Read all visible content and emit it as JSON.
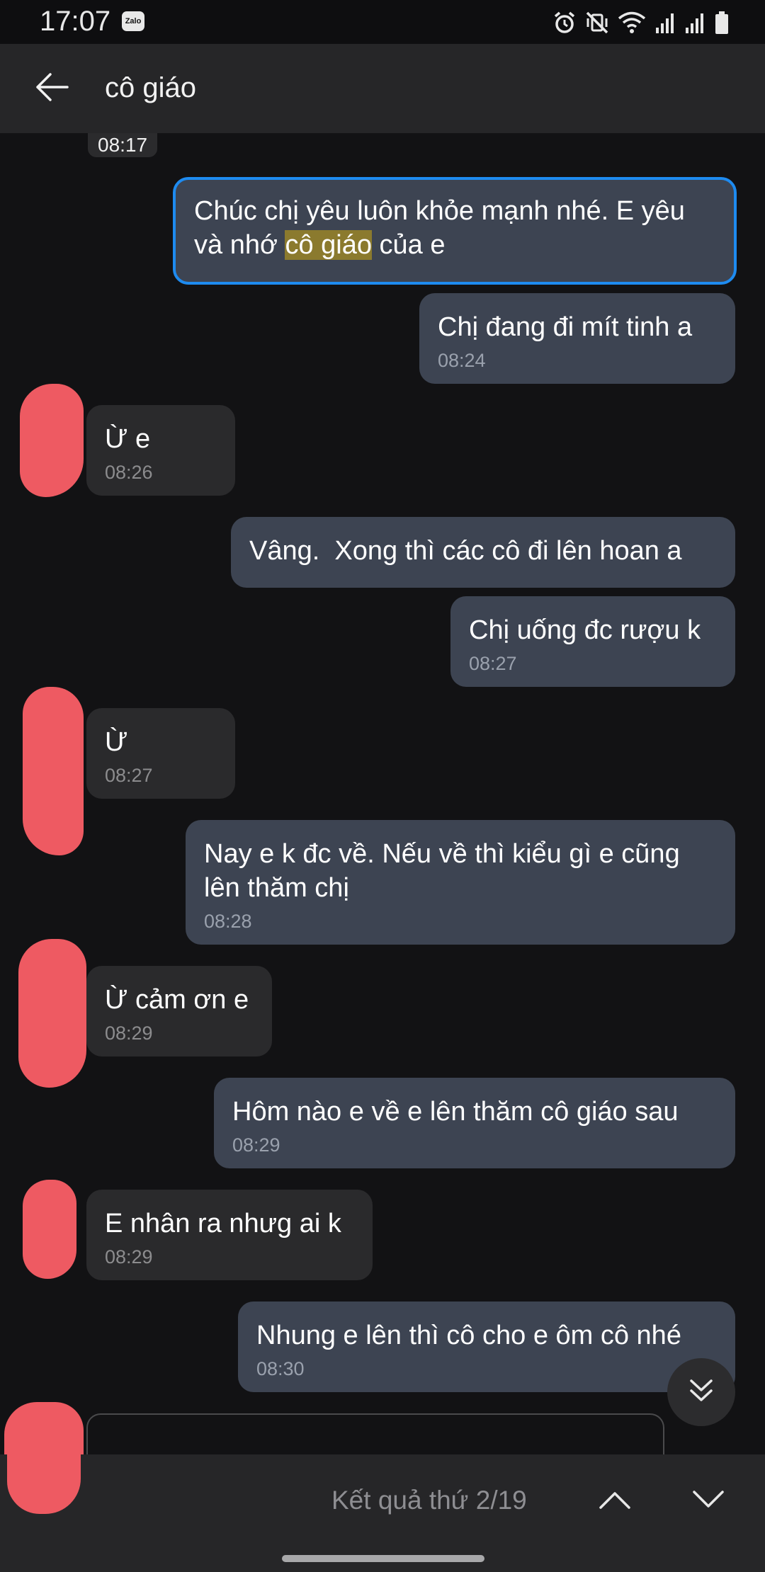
{
  "status_bar": {
    "time": "17:07",
    "app_badge": "Zalo",
    "icons": [
      "alarm-icon",
      "vibrate-mute-icon",
      "wifi-icon",
      "signal-icon",
      "signal-icon",
      "battery-icon"
    ]
  },
  "header": {
    "title": "cô giáo",
    "back_icon": "arrow-left-icon"
  },
  "chat": {
    "date_chip": "08:17",
    "messages": [
      {
        "direction": "sent",
        "text_before": "Chúc chị yêu luôn khỏe mạnh nhé. E yêu\nvà nhớ ",
        "highlight": "cô giáo",
        "text_after": " của e",
        "time": "",
        "highlighted_result": true
      },
      {
        "direction": "sent",
        "text": "Chị đang đi mít tinh a",
        "time": "08:24"
      },
      {
        "direction": "recv",
        "text": "Ừ e",
        "time": "08:26"
      },
      {
        "direction": "sent",
        "text": "Vâng.  Xong thì các cô đi lên hoan a",
        "time": ""
      },
      {
        "direction": "sent",
        "text": "Chị uống đc rượu k",
        "time": "08:27"
      },
      {
        "direction": "recv",
        "text": "Ừ",
        "time": "08:27"
      },
      {
        "direction": "sent",
        "text": "Nay e k đc về. Nếu về thì kiểu gì e cũng\nlên thăm chị",
        "time": "08:28"
      },
      {
        "direction": "recv",
        "text": "Ừ cảm ơn e",
        "time": "08:29"
      },
      {
        "direction": "sent",
        "text": "Hôm nào e về e lên thăm cô giáo sau",
        "time": "08:29"
      },
      {
        "direction": "recv",
        "text": "E nhân ra nhưg ai k",
        "time": "08:29"
      },
      {
        "direction": "sent",
        "text": "Nhung e lên thì cô cho e ôm cô nhé",
        "time": "08:30"
      }
    ],
    "scroll_down_icon": "double-chevron-down-icon"
  },
  "search_results": {
    "label": "Kết quả thứ 2/19",
    "prev_icon": "chevron-up-icon",
    "next_icon": "chevron-down-icon"
  },
  "colors": {
    "background": "#121214",
    "header": "#262628",
    "sent_bubble": "#3d4452",
    "received_bubble": "#2a2a2c",
    "highlight_border": "#1e8bf0",
    "search_highlight": "#8b7a2e",
    "redaction": "#ee5a62"
  }
}
